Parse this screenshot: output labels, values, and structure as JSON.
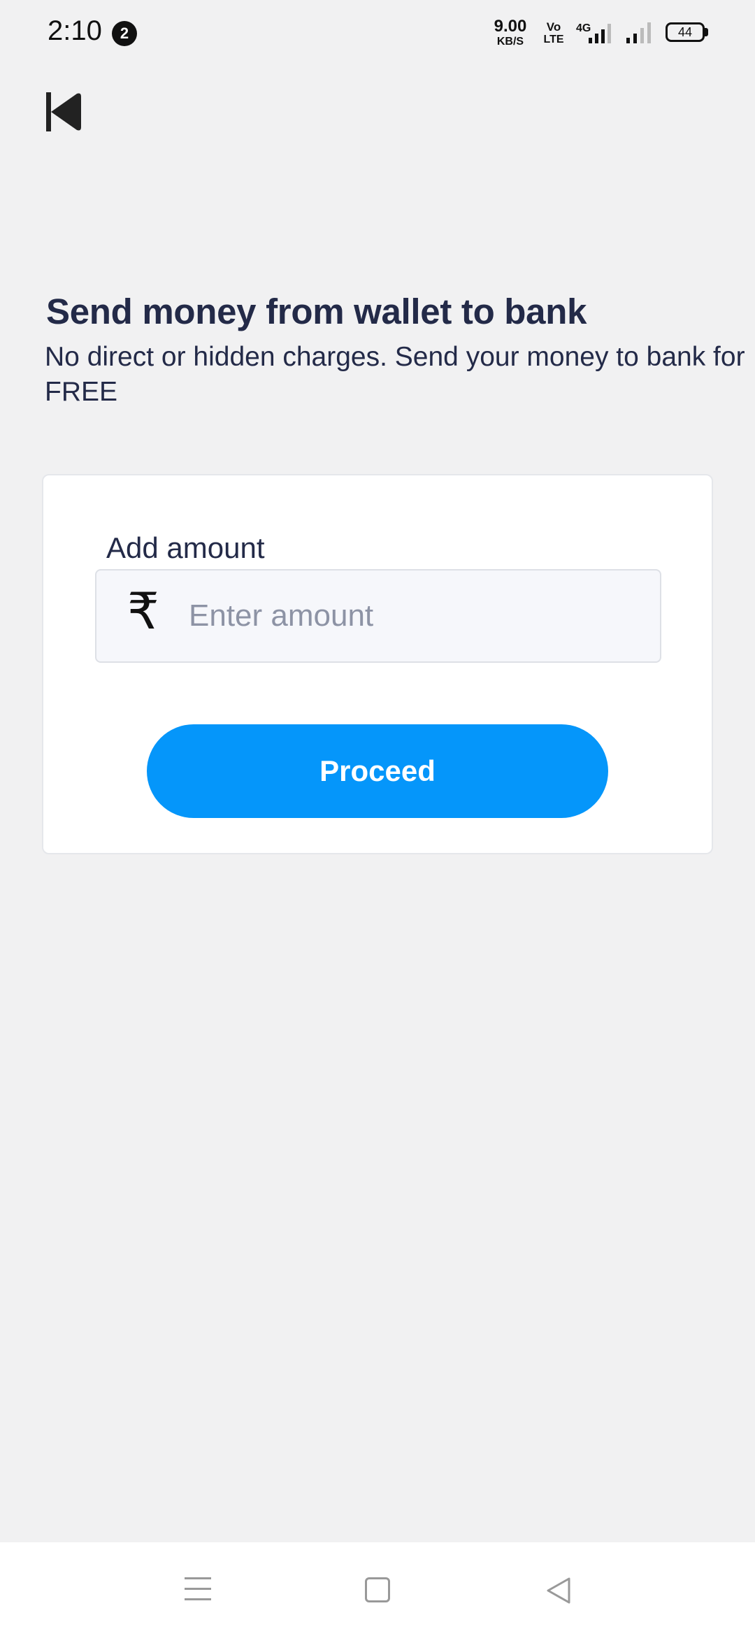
{
  "status_bar": {
    "time": "2:10",
    "notification_count": "2",
    "net_speed_value": "9.00",
    "net_speed_unit": "KB/S",
    "volte_top": "Vo",
    "volte_bottom": "LTE",
    "network_type": "4G",
    "battery": "44"
  },
  "header": {
    "title": "Send money from wallet to bank",
    "subtitle": "No direct or hidden charges. Send your money to bank for FREE"
  },
  "form": {
    "amount_label": "Add amount",
    "currency_symbol": "₹",
    "amount_placeholder": "Enter amount",
    "amount_value": "",
    "proceed_label": "Proceed"
  },
  "colors": {
    "accent": "#0596fa",
    "background": "#f1f1f2",
    "text": "#232a48"
  }
}
